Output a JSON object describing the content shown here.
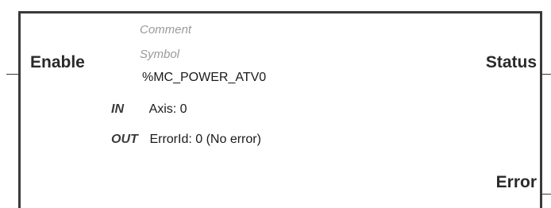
{
  "block": {
    "comment": "Comment",
    "symbol_label": "Symbol",
    "instance_name": "%MC_POWER_ATV0",
    "inputs": [
      {
        "name": "Enable"
      }
    ],
    "outputs": [
      {
        "name": "Status"
      },
      {
        "name": "Error"
      }
    ],
    "in_label": "IN",
    "in_value": "Axis: 0",
    "out_label": "OUT",
    "out_value": "ErrorId: 0 (No error)"
  },
  "colors": {
    "border": "#3a3a3a",
    "text": "#1a1a1a",
    "placeholder": "#9a9a9a",
    "background": "#ffffff"
  }
}
